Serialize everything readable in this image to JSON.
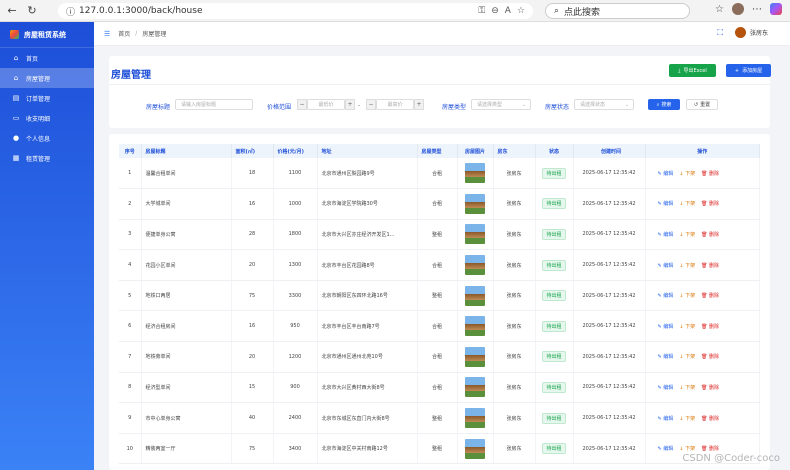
{
  "browser": {
    "url": "127.0.0.1:3000/back/house",
    "search_placeholder": "点此搜索"
  },
  "app": {
    "title": "房屋租赁系统"
  },
  "sidebar": {
    "items": [
      {
        "label": "首页",
        "icon": "home-icon"
      },
      {
        "label": "房屋管理",
        "icon": "house-icon",
        "active": true
      },
      {
        "label": "订单管理",
        "icon": "order-icon"
      },
      {
        "label": "收支明细",
        "icon": "wallet-icon"
      },
      {
        "label": "个人信息",
        "icon": "user-icon"
      },
      {
        "label": "租赁管理",
        "icon": "lease-icon"
      }
    ]
  },
  "header": {
    "breadcrumb_home": "首页",
    "breadcrumb_sep": "/",
    "breadcrumb_current": "房屋管理",
    "user_name": "张房东"
  },
  "page": {
    "title": "房屋管理",
    "export_label": "导出Excel",
    "add_label": "添加房屋"
  },
  "filter": {
    "title_label": "房屋标题",
    "title_placeholder": "请输入房屋标题",
    "price_label": "价格范围",
    "min_placeholder": "最低价",
    "max_placeholder": "最高价",
    "dash": "-",
    "type_label": "房屋类型",
    "type_placeholder": "请选择类型",
    "status_label": "房屋状态",
    "status_placeholder": "请选择状态",
    "search_label": "搜索",
    "reset_label": "重置"
  },
  "table": {
    "headers": [
      "序号",
      "房屋标题",
      "面积(㎡)",
      "价格(元/月)",
      "地址",
      "房屋类型",
      "房屋图片",
      "房东",
      "状态",
      "创建时间",
      "操作"
    ],
    "edit_label": "编辑",
    "down_label": "下架",
    "delete_label": "删除",
    "rows": [
      {
        "no": "1",
        "title": "温馨合租单间",
        "area": "18",
        "price": "1100",
        "address": "北京市通州区梨园路9号",
        "type": "合租",
        "landlord": "张房东",
        "status": "待出租",
        "created": "2025-06-17 12:35:42"
      },
      {
        "no": "2",
        "title": "大学城单间",
        "area": "16",
        "price": "1000",
        "address": "北京市海淀区学院路30号",
        "type": "合租",
        "landlord": "张房东",
        "status": "待出租",
        "created": "2025-06-17 12:35:42"
      },
      {
        "no": "3",
        "title": "便捷单身公寓",
        "area": "28",
        "price": "1800",
        "address": "北京市大兴区亦庄经济开发区1...",
        "type": "整租",
        "landlord": "张房东",
        "status": "待出租",
        "created": "2025-06-17 12:35:42"
      },
      {
        "no": "4",
        "title": "花园小区单间",
        "area": "20",
        "price": "1300",
        "address": "北京市丰台区花园路8号",
        "type": "合租",
        "landlord": "张房东",
        "status": "待出租",
        "created": "2025-06-17 12:35:42"
      },
      {
        "no": "5",
        "title": "地铁口两居",
        "area": "75",
        "price": "3300",
        "address": "北京市朝阳区东四环北路16号",
        "type": "整租",
        "landlord": "张房东",
        "status": "待出租",
        "created": "2025-06-17 12:35:42"
      },
      {
        "no": "6",
        "title": "经济合租房间",
        "area": "16",
        "price": "950",
        "address": "北京市丰台区丰台南路7号",
        "type": "合租",
        "landlord": "张房东",
        "status": "待出租",
        "created": "2025-06-17 12:35:42"
      },
      {
        "no": "7",
        "title": "地铁旁单间",
        "area": "20",
        "price": "1200",
        "address": "北京市通州区通州北苑10号",
        "type": "合租",
        "landlord": "张房东",
        "status": "待出租",
        "created": "2025-06-17 12:35:42"
      },
      {
        "no": "8",
        "title": "经济型单间",
        "area": "15",
        "price": "900",
        "address": "北京市大兴区黄村西大街8号",
        "type": "合租",
        "landlord": "张房东",
        "status": "待出租",
        "created": "2025-06-17 12:35:42"
      },
      {
        "no": "9",
        "title": "市中心单身公寓",
        "area": "40",
        "price": "2400",
        "address": "北京市东城区东直门内大街8号",
        "type": "整租",
        "landlord": "张房东",
        "status": "待出租",
        "created": "2025-06-17 12:35:42"
      },
      {
        "no": "10",
        "title": "精装两室一厅",
        "area": "75",
        "price": "3400",
        "address": "北京市海淀区中关村南路12号",
        "type": "整租",
        "landlord": "张房东",
        "status": "待出租",
        "created": "2025-06-17 12:35:42"
      }
    ]
  },
  "watermark": "CSDN @Coder-coco"
}
